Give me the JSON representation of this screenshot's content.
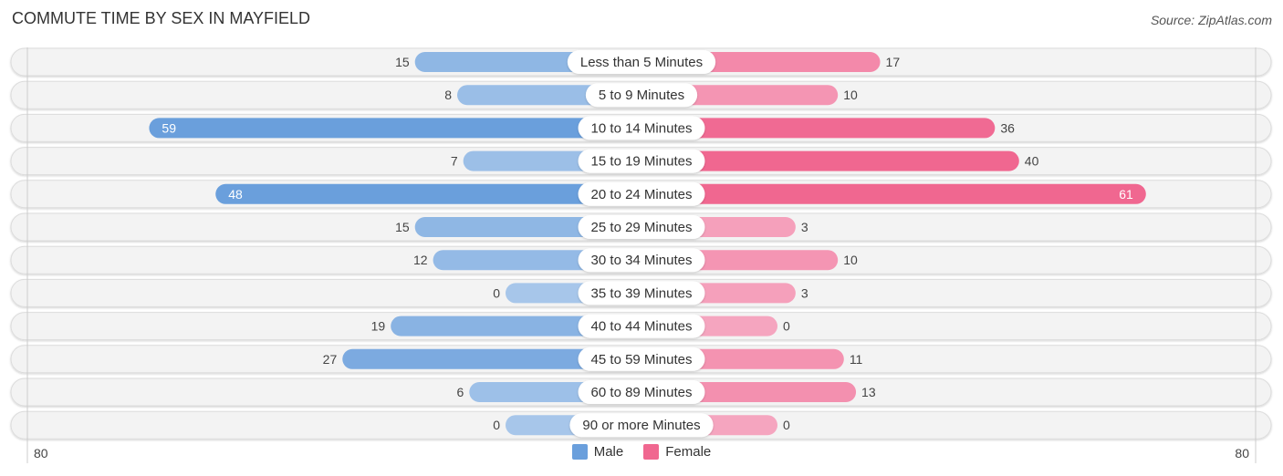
{
  "header": {
    "title": "COMMUTE TIME BY SEX IN MAYFIELD",
    "source": "Source: ZipAtlas.com"
  },
  "colors": {
    "male_strong": "#6a9fdc",
    "male_light": "#a7c6ea",
    "female_strong": "#f06790",
    "female_light": "#f5a5bf",
    "track": "#f3f3f3"
  },
  "chart_data": {
    "type": "bar",
    "orientation": "horizontal-diverging",
    "title": "COMMUTE TIME BY SEX IN MAYFIELD",
    "categories": [
      "Less than 5 Minutes",
      "5 to 9 Minutes",
      "10 to 14 Minutes",
      "15 to 19 Minutes",
      "20 to 24 Minutes",
      "25 to 29 Minutes",
      "30 to 34 Minutes",
      "35 to 39 Minutes",
      "40 to 44 Minutes",
      "45 to 59 Minutes",
      "60 to 89 Minutes",
      "90 or more Minutes"
    ],
    "series": [
      {
        "name": "Male",
        "side": "left",
        "values": [
          15,
          8,
          59,
          7,
          48,
          15,
          12,
          0,
          19,
          27,
          6,
          0
        ]
      },
      {
        "name": "Female",
        "side": "right",
        "values": [
          17,
          10,
          36,
          40,
          61,
          3,
          10,
          3,
          0,
          11,
          13,
          0
        ]
      }
    ],
    "axis": {
      "left_max_label": "80",
      "right_max_label": "80",
      "range": [
        0,
        80
      ]
    },
    "legend": {
      "position": "bottom-center",
      "entries": [
        "Male",
        "Female"
      ]
    },
    "grid": false
  }
}
